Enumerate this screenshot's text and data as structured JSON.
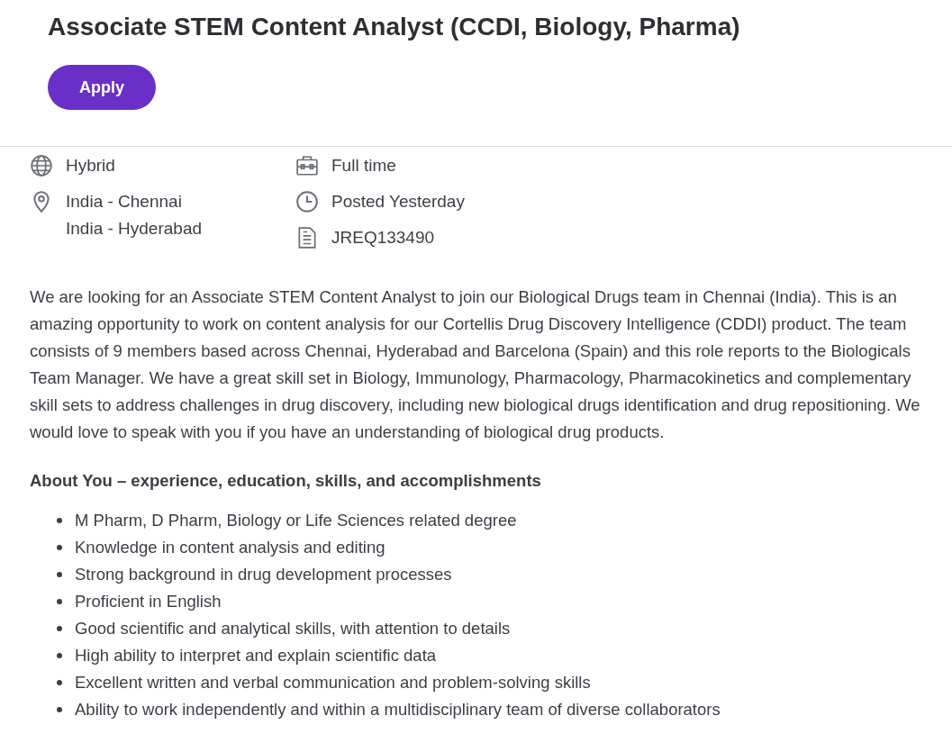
{
  "job": {
    "title": "Associate STEM Content Analyst (CCDI, Biology, Pharma)",
    "apply_button": "Apply"
  },
  "details": {
    "columns": [
      {
        "items": [
          {
            "kind": "globe",
            "lines": [
              "Hybrid"
            ]
          },
          {
            "kind": "pin",
            "lines": [
              "India - Chennai",
              "India - Hyderabad"
            ]
          }
        ]
      },
      {
        "items": [
          {
            "kind": "briefcase",
            "lines": [
              "Full time"
            ]
          },
          {
            "kind": "clock",
            "lines": [
              "Posted Yesterday"
            ]
          },
          {
            "kind": "document",
            "lines": [
              "JREQ133490"
            ]
          }
        ]
      }
    ]
  },
  "description": "We are looking for an Associate STEM Content Analyst to join our Biological Drugs team in Chennai (India). This is an amazing opportunity to work on content analysis for our Cortellis Drug Discovery Intelligence (CDDI) product. The team consists of 9 members based across Chennai, Hyderabad and Barcelona (Spain) and this role reports to the Biologicals Team Manager. We have a great skill set in Biology, Immunology, Pharmacology, Pharmacokinetics and complementary skill sets to address challenges in drug discovery, including new biological drugs identification and drug repositioning. We would love to speak with you if you have an understanding of biological drug products.",
  "about": {
    "heading": "About You – experience, education, skills, and accomplishments",
    "bullets": [
      "M Pharm, D Pharm, Biology or Life Sciences related degree",
      "Knowledge in content analysis and editing",
      "Strong background in drug development processes",
      "Proficient in English",
      "Good scientific and analytical skills, with attention to details",
      "High ability to interpret and explain scientific data",
      "Excellent written and verbal communication and problem-solving skills",
      "Ability to work independently and within a multidisciplinary team of diverse collaborators"
    ]
  }
}
